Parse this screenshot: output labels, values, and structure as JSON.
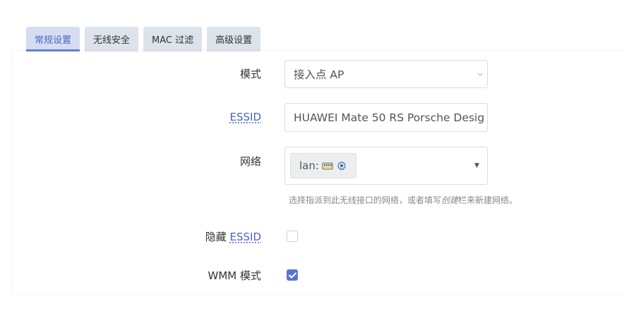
{
  "tabs": [
    {
      "label": "常规设置",
      "active": true
    },
    {
      "label": "无线安全",
      "active": false
    },
    {
      "label": "MAC 过滤",
      "active": false
    },
    {
      "label": "高级设置",
      "active": false
    }
  ],
  "form": {
    "mode_label": "模式",
    "mode_value": "接入点 AP",
    "essid_label": "ESSID",
    "essid_value": "HUAWEI Mate 50 RS Porsche Desig",
    "network_label": "网络",
    "network_chip": "lan:",
    "network_hint_prefix": "选择指派到此无线接口的网络，或者填写",
    "network_hint_em": "创建",
    "network_hint_suffix": "栏来新建网络。",
    "hide_label_prefix": "隐藏",
    "hide_label_link": "ESSID",
    "hide_checked": false,
    "wmm_label": "WMM 模式",
    "wmm_checked": true
  },
  "colors": {
    "accent": "#5b73d6",
    "tab_active_text": "#4a64c8"
  }
}
